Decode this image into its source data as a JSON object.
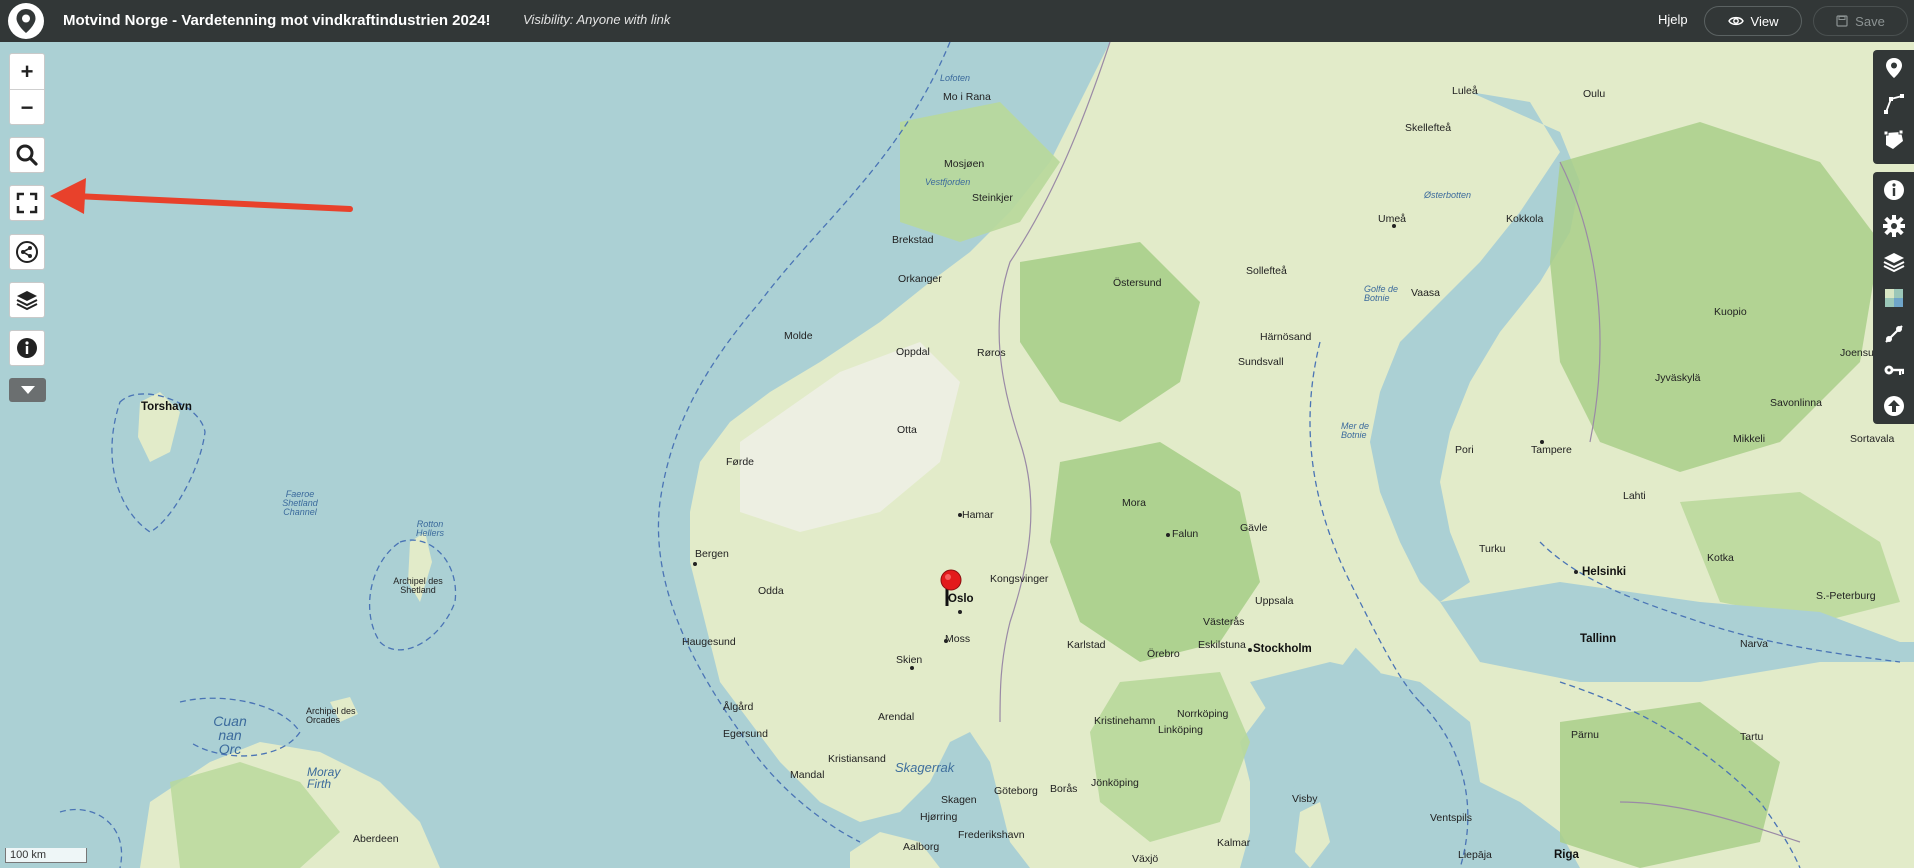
{
  "header": {
    "title": "Motvind Norge - Vardetenning mot vindkraftindustrien 2024!",
    "visibility": "Visibility: Anyone with link",
    "help": "Hjelp",
    "view": "View",
    "save": "Save"
  },
  "left_controls": {
    "zoom_in": "+",
    "zoom_out": "−"
  },
  "icons": {
    "logo": "map-marker-logo",
    "view": "eye-icon",
    "save": "floppy-disk-icon",
    "search": "search-icon",
    "fullscreen": "fullscreen-icon",
    "share": "share-icon",
    "layers": "layers-icon",
    "info": "info-icon",
    "more": "caret-down-icon",
    "right_toolbar": [
      "marker-icon",
      "polyline-icon",
      "polygon-icon",
      "info-icon",
      "gear-icon",
      "layers-icon",
      "tile-layer-icon",
      "edit-link-icon",
      "key-icon",
      "upload-icon"
    ]
  },
  "colors": {
    "header": "#323737",
    "sea": "#abd0d4",
    "land": "#e2ebc9",
    "forest": "#a9cf8a",
    "arrow": "#e8412b",
    "pin": "#e31a1c"
  },
  "scale_label": "100 km",
  "map": {
    "cities": [
      {
        "name": "Oslo",
        "big": true
      },
      {
        "name": "Stockholm",
        "big": true
      },
      {
        "name": "Helsinki",
        "big": true
      },
      {
        "name": "Tallinn",
        "big": true
      },
      {
        "name": "Riga",
        "big": true
      },
      {
        "name": "Torshavn",
        "big": true
      },
      {
        "name": "Bergen"
      },
      {
        "name": "Haugesund"
      },
      {
        "name": "Egersund"
      },
      {
        "name": "Ålgård"
      },
      {
        "name": "Kristiansand"
      },
      {
        "name": "Mandal"
      },
      {
        "name": "Arendal"
      },
      {
        "name": "Skien"
      },
      {
        "name": "Moss"
      },
      {
        "name": "Hamar"
      },
      {
        "name": "Otta"
      },
      {
        "name": "Oppdal"
      },
      {
        "name": "Røros"
      },
      {
        "name": "Orkanger"
      },
      {
        "name": "Steinkjer"
      },
      {
        "name": "Brekstad"
      },
      {
        "name": "Molde"
      },
      {
        "name": "Førde"
      },
      {
        "name": "Odda"
      },
      {
        "name": "Kongsvinger"
      },
      {
        "name": "Karlstad"
      },
      {
        "name": "Falun"
      },
      {
        "name": "Gävle"
      },
      {
        "name": "Uppsala"
      },
      {
        "name": "Västerås"
      },
      {
        "name": "Örebro"
      },
      {
        "name": "Eskilstuna"
      },
      {
        "name": "Norrköping"
      },
      {
        "name": "Linköping"
      },
      {
        "name": "Jönköping"
      },
      {
        "name": "Göteborg"
      },
      {
        "name": "Borås"
      },
      {
        "name": "Östersund"
      },
      {
        "name": "Sundsvall"
      },
      {
        "name": "Härnösand"
      },
      {
        "name": "Umeå"
      },
      {
        "name": "Skellefteå"
      },
      {
        "name": "Luleå"
      },
      {
        "name": "Oulu"
      },
      {
        "name": "Kokkola"
      },
      {
        "name": "Vaasa"
      },
      {
        "name": "Pori"
      },
      {
        "name": "Turku"
      },
      {
        "name": "Tampere"
      },
      {
        "name": "Lahti"
      },
      {
        "name": "Kuopio"
      },
      {
        "name": "Jyväskylä"
      },
      {
        "name": "Mikkeli"
      },
      {
        "name": "Kotka"
      },
      {
        "name": "Narva"
      },
      {
        "name": "Tartu"
      },
      {
        "name": "Pärnu"
      },
      {
        "name": "Visby"
      },
      {
        "name": "Aalborg"
      },
      {
        "name": "Aberdeen"
      },
      {
        "name": "Kristinehamn"
      },
      {
        "name": "Mo i Rana"
      },
      {
        "name": "Mosjøen"
      },
      {
        "name": "Mora"
      },
      {
        "name": "Sollefteå"
      },
      {
        "name": "Kalmar"
      },
      {
        "name": "Växjö"
      },
      {
        "name": "Ventspils"
      },
      {
        "name": "Liepāja"
      },
      {
        "name": "Skagen"
      },
      {
        "name": "Hjørring"
      },
      {
        "name": "Frederikshavn"
      },
      {
        "name": "S.-Peterburg"
      },
      {
        "name": "Sortavala"
      },
      {
        "name": "Savonlinna"
      },
      {
        "name": "Joensuu"
      }
    ],
    "water": [
      {
        "name": "Skagerrak",
        "sea": true
      },
      {
        "name": "Faeroe Shetland Channel"
      },
      {
        "name": "Rotton Hellers"
      },
      {
        "name": "Archipel des Shetland"
      },
      {
        "name": "Archipel des Orcades"
      },
      {
        "name": "Moray Firth"
      },
      {
        "name": "Cuan nan Orc"
      },
      {
        "name": "Golfe de Botnie"
      },
      {
        "name": "Mer de Botnie"
      },
      {
        "name": "Østerbotten"
      },
      {
        "name": "Vestfjorden"
      },
      {
        "name": "Lofoten"
      }
    ]
  }
}
